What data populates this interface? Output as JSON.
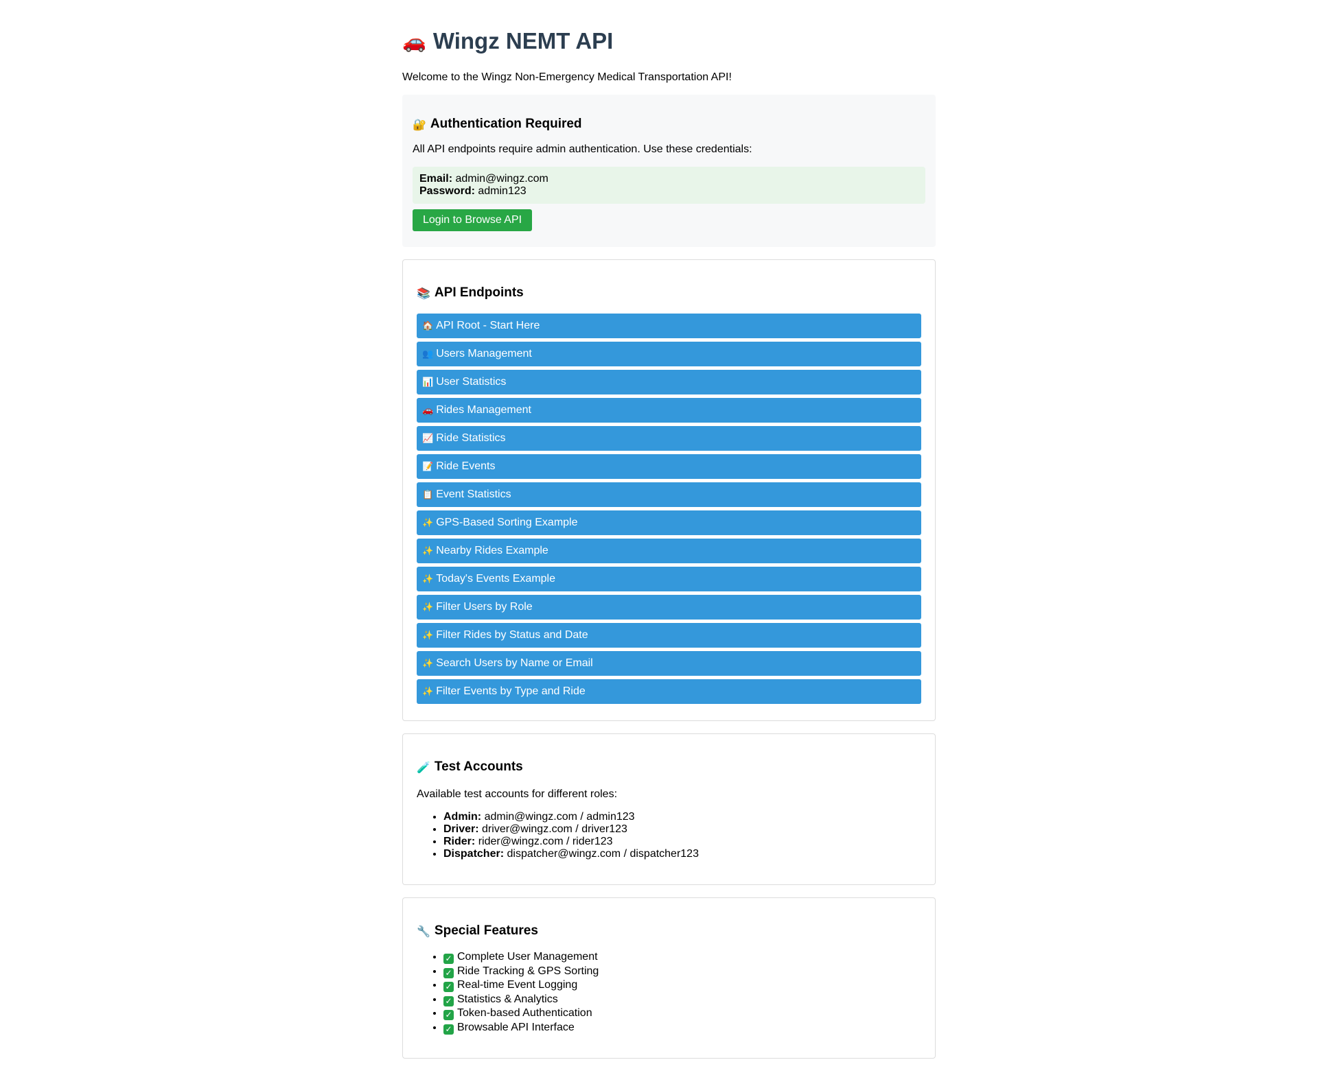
{
  "header": {
    "icon": "🚗",
    "title": "Wingz NEMT API",
    "intro": "Welcome to the Wingz Non-Emergency Medical Transportation API!"
  },
  "auth": {
    "icon": "🔐",
    "title": "Authentication Required",
    "description": "All API endpoints require admin authentication. Use these credentials:",
    "email_label": "Email:",
    "email_value": "admin@wingz.com",
    "password_label": "Password:",
    "password_value": "admin123",
    "login_button": "Login to Browse API"
  },
  "endpoints": {
    "icon": "📚",
    "title": "API Endpoints",
    "items": [
      {
        "icon": "🏠",
        "label": "API Root - Start Here"
      },
      {
        "icon": "👥",
        "label": "Users Management"
      },
      {
        "icon": "📊",
        "label": "User Statistics"
      },
      {
        "icon": "🚗",
        "label": "Rides Management"
      },
      {
        "icon": "📈",
        "label": "Ride Statistics"
      },
      {
        "icon": "📝",
        "label": "Ride Events"
      },
      {
        "icon": "📋",
        "label": "Event Statistics"
      },
      {
        "icon": "✨",
        "label": "GPS-Based Sorting Example"
      },
      {
        "icon": "✨",
        "label": "Nearby Rides Example"
      },
      {
        "icon": "✨",
        "label": "Today's Events Example"
      },
      {
        "icon": "✨",
        "label": "Filter Users by Role"
      },
      {
        "icon": "✨",
        "label": "Filter Rides by Status and Date"
      },
      {
        "icon": "✨",
        "label": "Search Users by Name or Email"
      },
      {
        "icon": "✨",
        "label": "Filter Events by Type and Ride"
      }
    ]
  },
  "test_accounts": {
    "icon": "🧪",
    "title": "Test Accounts",
    "intro": "Available test accounts for different roles:",
    "items": [
      {
        "role": "Admin:",
        "creds": "admin@wingz.com / admin123"
      },
      {
        "role": "Driver:",
        "creds": "driver@wingz.com / driver123"
      },
      {
        "role": "Rider:",
        "creds": "rider@wingz.com / rider123"
      },
      {
        "role": "Dispatcher:",
        "creds": "dispatcher@wingz.com / dispatcher123"
      }
    ]
  },
  "features": {
    "icon": "🔧",
    "title": "Special Features",
    "check_icon": "✓",
    "items": [
      "Complete User Management",
      "Ride Tracking & GPS Sorting",
      "Real-time Event Logging",
      "Statistics & Analytics",
      "Token-based Authentication",
      "Browsable API Interface"
    ]
  },
  "colors": {
    "title": "#2c3e50",
    "endpoint_bg": "#3498db",
    "login_button": "#28a745",
    "credentials_bg": "#e8f5e9",
    "check": "#22a447"
  }
}
